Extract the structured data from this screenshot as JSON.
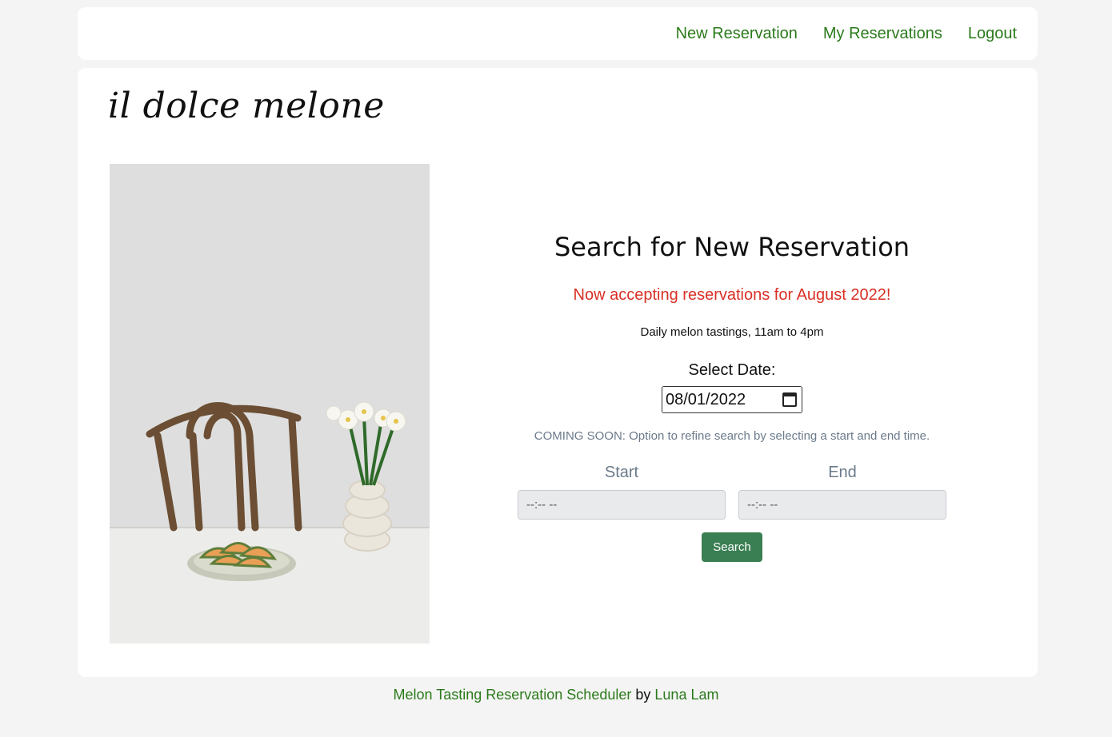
{
  "nav": {
    "new_reservation": "New Reservation",
    "my_reservations": "My Reservations",
    "logout": "Logout"
  },
  "brand": "il dolce melone",
  "main": {
    "heading": "Search for New Reservation",
    "announcement": "Now accepting reservations for August 2022!",
    "hours": "Daily melon tastings, 11am to 4pm",
    "date_label": "Select Date:",
    "date_value": "08/01/2022",
    "coming_soon": "COMING SOON: Option to refine search by selecting a start and end time.",
    "start_label": "Start",
    "end_label": "End",
    "start_placeholder": "--:-- --",
    "end_placeholder": "--:-- --",
    "search_label": "Search"
  },
  "footer": {
    "app_link": "Melon Tasting Reservation Scheduler",
    "by": "by",
    "author_link": "Luna Lam"
  },
  "colors": {
    "link_green": "#2b7a1b",
    "announce_red": "#d93025",
    "button_green": "#3a7f53",
    "muted": "#6b7a8a"
  }
}
